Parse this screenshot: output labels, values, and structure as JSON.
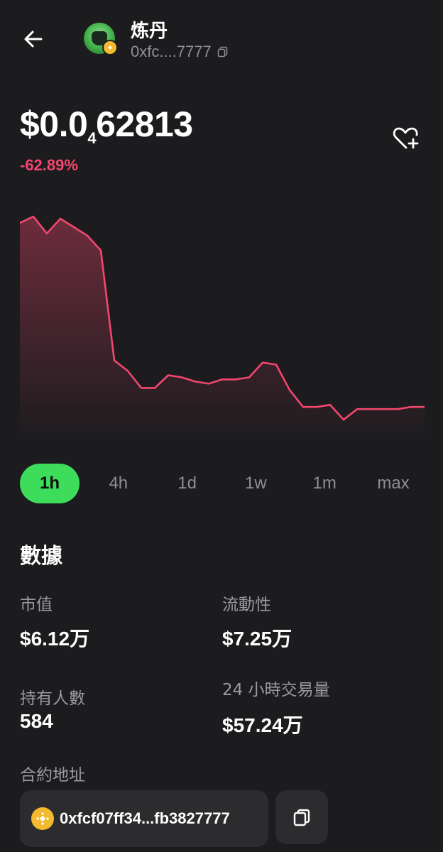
{
  "header": {
    "token_name": "炼丹",
    "token_address_short": "0xfc....7777"
  },
  "price": {
    "prefix": "$0.0",
    "zero_count": "4",
    "digits": "62813",
    "change": "-62.89%"
  },
  "chart_data": {
    "type": "area",
    "color": "#f2466e",
    "values": [
      0.96,
      0.99,
      0.91,
      0.98,
      0.94,
      0.9,
      0.83,
      0.31,
      0.26,
      0.18,
      0.18,
      0.24,
      0.23,
      0.21,
      0.2,
      0.22,
      0.22,
      0.23,
      0.3,
      0.29,
      0.17,
      0.09,
      0.09,
      0.1,
      0.03,
      0.08,
      0.08,
      0.08,
      0.08,
      0.09,
      0.09
    ]
  },
  "time_tabs": [
    {
      "label": "1h",
      "active": true
    },
    {
      "label": "4h",
      "active": false
    },
    {
      "label": "1d",
      "active": false
    },
    {
      "label": "1w",
      "active": false
    },
    {
      "label": "1m",
      "active": false
    },
    {
      "label": "max",
      "active": false
    }
  ],
  "stats": {
    "title": "數據",
    "market_cap_label": "市值",
    "market_cap_value": "$6.12万",
    "liquidity_label": "流動性",
    "liquidity_value": "$7.25万",
    "holders_label": "持有人數",
    "holders_value": "584",
    "volume_label": "24 小時交易量",
    "volume_value": "$57.24万"
  },
  "contract": {
    "label": "合約地址",
    "address": "0xfcf07ff34...fb3827777"
  },
  "colors": {
    "accent_green": "#3ddc5b",
    "negative_red": "#f2466e",
    "background": "#1c1c1e",
    "card": "#2c2c2e",
    "bnb_yellow": "#f3ba2f"
  },
  "icons": {
    "back": "arrow-left-icon",
    "copy": "copy-icon",
    "favorite": "heart-plus-icon",
    "chain": "bnb-icon"
  }
}
